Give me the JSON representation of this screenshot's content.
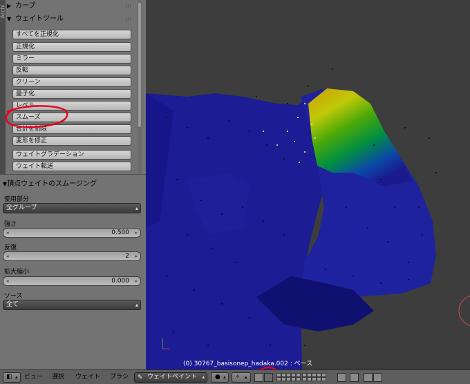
{
  "shelf": {
    "tab_label": "Archi",
    "curve_panel": {
      "title": "カーブ"
    },
    "weight_panel": {
      "title": "ウェイトツール"
    },
    "buttons": [
      "すべてを正規化",
      "正規化",
      "ミラー",
      "反転",
      "クリーン",
      "量子化",
      "レベル",
      "スムーズ",
      "合計を制限",
      "変形を修正",
      "ウェイトグラデーション",
      "ウェイト転送"
    ]
  },
  "operator": {
    "title": "頂点ウェイトのスムージング",
    "use_label": "使用部分",
    "use_value": "全グループ",
    "strength_label": "強さ",
    "strength_value": "0.500",
    "repeat_label": "反復",
    "repeat_value": "2",
    "expand_label": "拡大縮小",
    "expand_value": "0.000",
    "source_label": "ソース",
    "source_value": "全て"
  },
  "viewport": {
    "info": "(0) 30767_basisonep_hadaka.002 : ベース"
  },
  "header": {
    "menus": [
      "ビュー",
      "選択",
      "ウェイト",
      "ブラシ"
    ],
    "mode": "ウェイトペイント"
  },
  "colors": {
    "annotation": "#e8001c",
    "mesh_blue": "#1a1a8c"
  }
}
